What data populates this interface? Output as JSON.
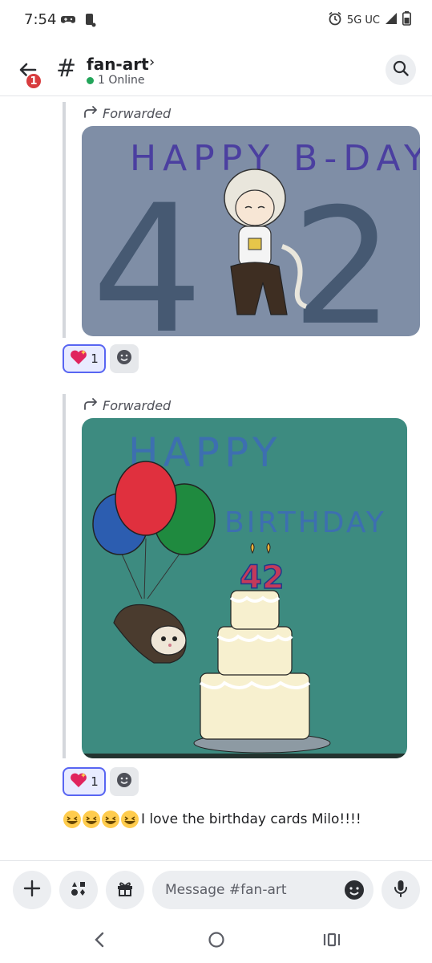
{
  "status_bar": {
    "time": "7:54",
    "network": "5G UC"
  },
  "header": {
    "back_badge": "1",
    "channel_name": "fan-art",
    "online_text": "1 Online"
  },
  "messages": [
    {
      "forwarded_label": "Forwarded",
      "image": {
        "heading": "HAPPY B-DAY!",
        "number_left": "4",
        "number_right": "2",
        "background": "#7f8ea6"
      },
      "reaction": {
        "emoji": "sparkling-heart",
        "count": "1"
      }
    },
    {
      "forwarded_label": "Forwarded",
      "image": {
        "heading_line1": "HAPPY",
        "heading_line2": "BIRTHDAY",
        "candle_number": "42",
        "background": "#3d8b80"
      },
      "reaction": {
        "emoji": "sparkling-heart",
        "count": "1"
      }
    }
  ],
  "text_message": {
    "emoji": [
      "grinning-squinting",
      "grinning-squinting",
      "grinning-squinting",
      "grinning-squinting"
    ],
    "text": "I love the birthday cards Milo!!!!"
  },
  "composer": {
    "placeholder": "Message #fan-art"
  },
  "colors": {
    "accent": "#5865f2",
    "online": "#23a55a",
    "badge": "#d83c3e"
  }
}
